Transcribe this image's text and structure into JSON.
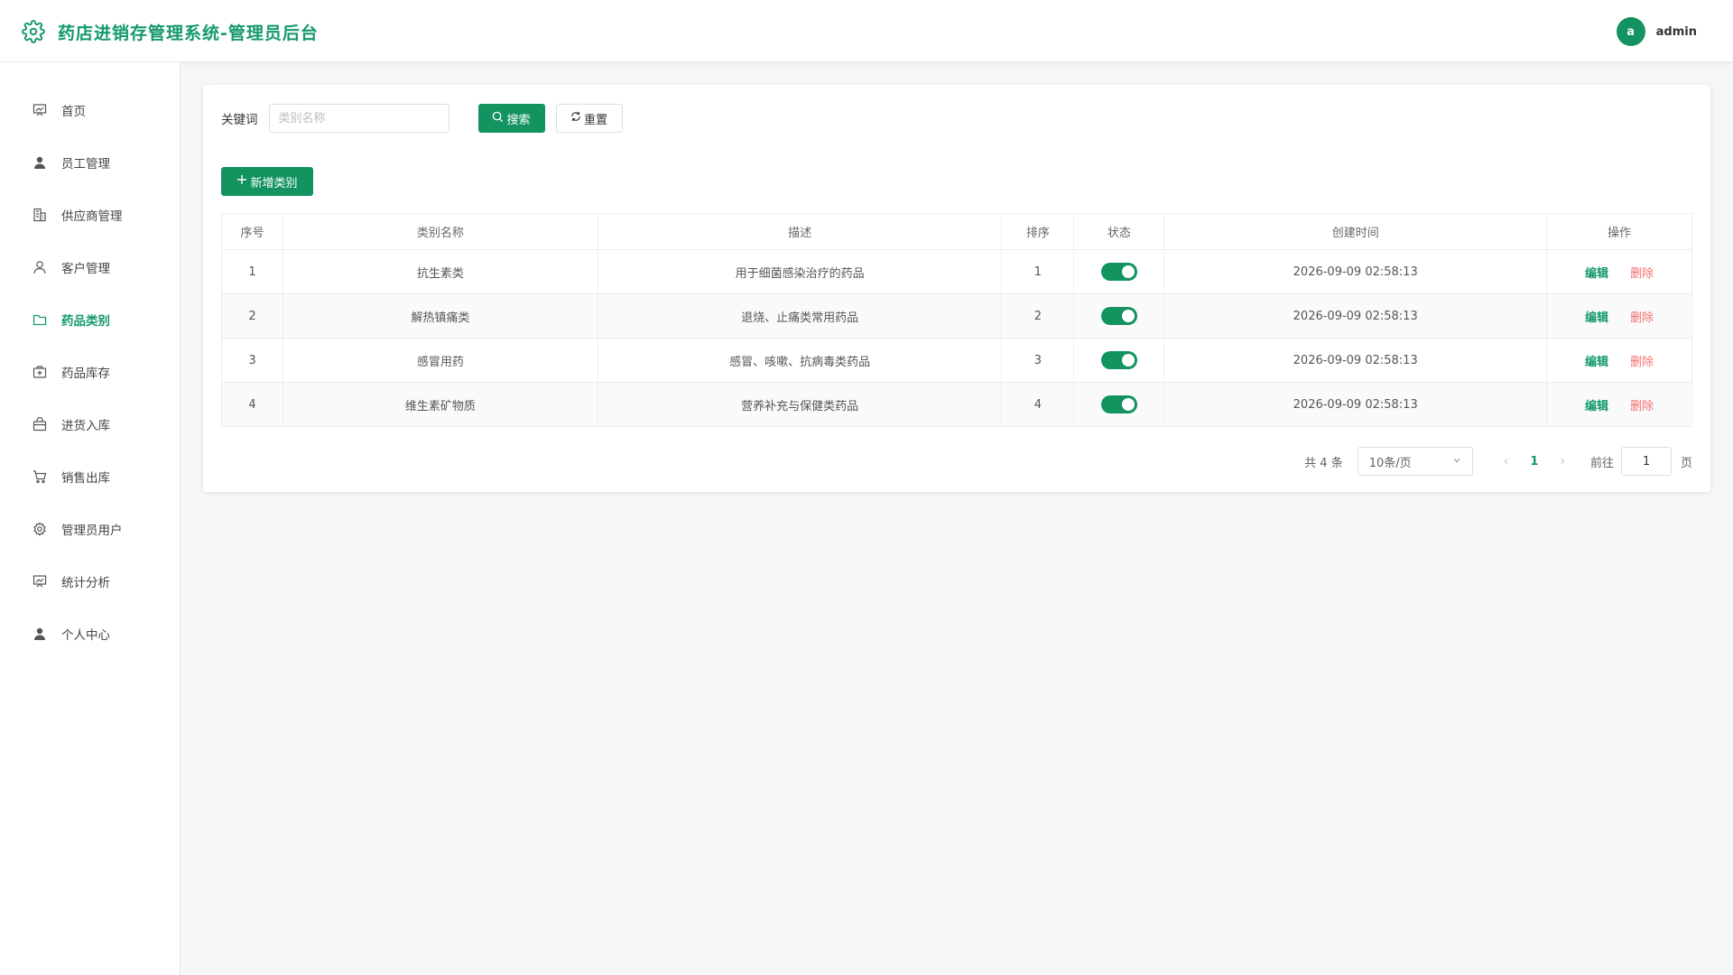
{
  "header": {
    "title": "药店进销存管理系统-管理员后台",
    "avatar_letter": "a",
    "username": "admin"
  },
  "sidebar": {
    "items": [
      {
        "label": "首页",
        "icon": "dashboard-icon"
      },
      {
        "label": "员工管理",
        "icon": "user-icon"
      },
      {
        "label": "供应商管理",
        "icon": "building-icon"
      },
      {
        "label": "客户管理",
        "icon": "person-outline-icon"
      },
      {
        "label": "药品类别",
        "icon": "folder-icon",
        "active": true
      },
      {
        "label": "药品库存",
        "icon": "medicine-box-icon"
      },
      {
        "label": "进货入库",
        "icon": "bag-icon"
      },
      {
        "label": "销售出库",
        "icon": "cart-icon"
      },
      {
        "label": "管理员用户",
        "icon": "gear-icon"
      },
      {
        "label": "统计分析",
        "icon": "chart-board-icon"
      },
      {
        "label": "个人中心",
        "icon": "user-icon"
      }
    ]
  },
  "search": {
    "label": "关键词",
    "placeholder": "类别名称",
    "search_label": "搜索",
    "reset_label": "重置"
  },
  "add_label": "新增类别",
  "table": {
    "headers": [
      "序号",
      "类别名称",
      "描述",
      "排序",
      "状态",
      "创建时间",
      "操作"
    ],
    "rows": [
      {
        "index": "1",
        "name": "抗生素类",
        "desc": "用于细菌感染治疗的药品",
        "sort": "1",
        "status": true,
        "created": "2026-09-09 02:58:13"
      },
      {
        "index": "2",
        "name": "解热镇痛类",
        "desc": "退烧、止痛类常用药品",
        "sort": "2",
        "status": true,
        "created": "2026-09-09 02:58:13"
      },
      {
        "index": "3",
        "name": "感冒用药",
        "desc": "感冒、咳嗽、抗病毒类药品",
        "sort": "3",
        "status": true,
        "created": "2026-09-09 02:58:13"
      },
      {
        "index": "4",
        "name": "维生素矿物质",
        "desc": "营养补充与保健类药品",
        "sort": "4",
        "status": true,
        "created": "2026-09-09 02:58:13"
      }
    ],
    "edit_label": "编辑",
    "delete_label": "删除"
  },
  "pagination": {
    "total": "共 4 条",
    "page_size": "10条/页",
    "current_page": "1",
    "goto_label": "前往",
    "goto_value": "1",
    "unit": "页"
  },
  "colors": {
    "primary": "#12935f",
    "danger": "#f56c6c"
  }
}
